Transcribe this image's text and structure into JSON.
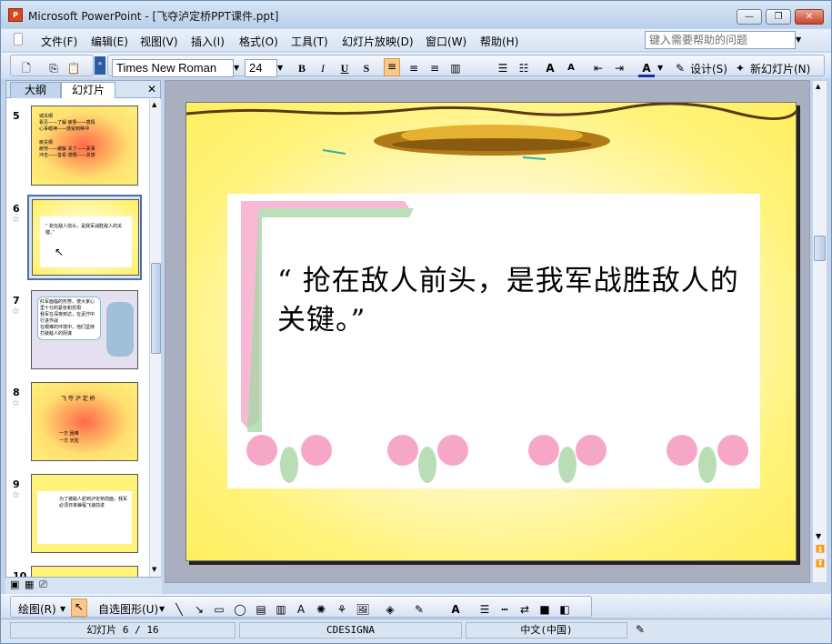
{
  "window": {
    "title": "Microsoft PowerPoint - [飞夺泸定桥PPT课件.ppt]",
    "app_icon": "P"
  },
  "window_buttons": {
    "minimize": "—",
    "restore": "❐",
    "close": "✕"
  },
  "menu": {
    "items": [
      "文件(F)",
      "编辑(E)",
      "视图(V)",
      "插入(I)",
      "格式(O)",
      "工具(T)",
      "幻灯片放映(D)",
      "窗口(W)",
      "帮助(H)"
    ],
    "help_placeholder": "键入需要帮助的问题"
  },
  "toolbar": {
    "font_name": "Times New Roman",
    "font_size": "24",
    "bold": "B",
    "italic": "I",
    "underline": "U",
    "shadow": "S",
    "design_label": "设计(S)",
    "new_slide_label": "新幻灯片(N)"
  },
  "pane": {
    "tabs": [
      "大纲",
      "幻灯片"
    ],
    "close": "✕",
    "thumbnails": [
      {
        "number": "5",
        "lines": [
          "城关纲",
          "看见——了解   疲惫——感情",
          "心事眼神——感受到种冲",
          "疲关纲",
          "疲劳——缓解   关了——关事",
          "冲击——善看   感慨——关感"
        ]
      },
      {
        "number": "6",
        "text": "“  抢在敌人前头，是我军战胜敌人的关键。”"
      },
      {
        "number": "7",
        "lines": [
          "红军面临的形势，使大家心里十分的紧张和恐惧",
          "我军在深夜到达，在泥泞中行进作战",
          "在艰难的环境中，他们坚持打破敌人的阴谋"
        ]
      },
      {
        "number": "8",
        "lines": [
          "飞 夺 泸 定 桥",
          "一方 困难",
          "一方 天险"
        ]
      },
      {
        "number": "9",
        "lines": [
          "为了被敌人赶到泸定桥前面，我军必须日夜兼程飞速前进"
        ]
      },
      {
        "number": "10"
      }
    ]
  },
  "slide": {
    "text": "“  抢在敌人前头，是我军战胜敌人的关键。”"
  },
  "drawing": {
    "draw_label": "绘图(R)",
    "autoshape_label": "自选图形(U)"
  },
  "status": {
    "slide_position": "幻灯片 6 / 16",
    "design": "CDESIGNA",
    "language": "中文(中国)"
  }
}
